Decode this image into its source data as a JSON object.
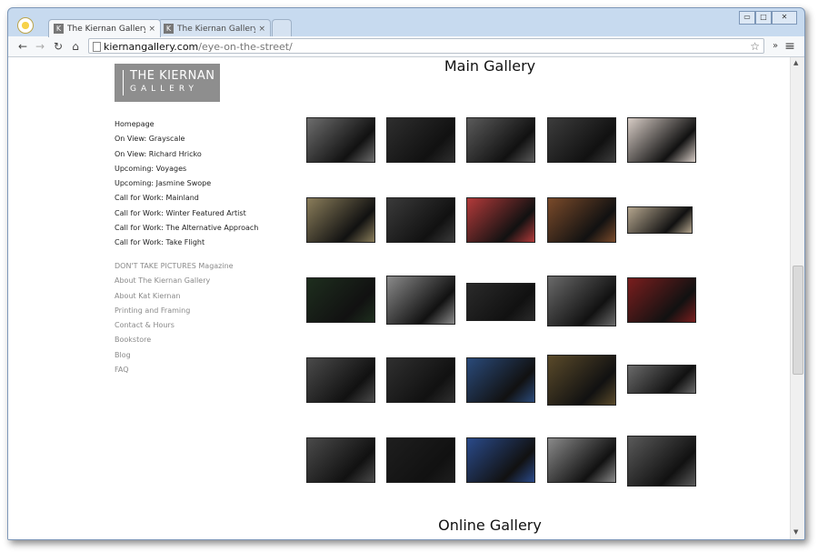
{
  "browser": {
    "tabs": [
      {
        "title": "The Kiernan Gallery - On V",
        "favicon": "K",
        "active": true
      },
      {
        "title": "The Kiernan Gallery: Eye o",
        "favicon": "K",
        "active": false
      }
    ],
    "url_host": "kiernangallery.com",
    "url_path": "/eye-on-the-street/",
    "icons": {
      "back": "←",
      "forward": "→",
      "reload": "↻",
      "home": "⌂",
      "star": "☆",
      "extensions": "»",
      "menu": "≡",
      "close": "×",
      "minimize": "▭",
      "maximize": "□",
      "window_close": "✕"
    }
  },
  "site": {
    "logo_line1": "THE KIERNAN",
    "logo_line2": "GALLERY",
    "nav_primary": [
      "Homepage",
      "On View: Grayscale",
      "On View: Richard Hricko",
      "Upcoming: Voyages",
      "Upcoming: Jasmine Swope",
      "Call for Work: Mainland",
      "Call for Work: Winter Featured Artist",
      "Call for Work: The Alternative Approach",
      "Call for Work: Take Flight"
    ],
    "nav_secondary": [
      "DON'T TAKE PICTURES Magazine",
      "About The Kiernan Gallery",
      "About Kat Kiernan",
      "Printing and Framing",
      "Contact & Hours",
      "Bookstore",
      "Blog",
      "FAQ"
    ]
  },
  "main": {
    "heading": "Main Gallery",
    "heading2": "Online Gallery",
    "thumbnails": [
      {
        "fill": "#6d6d6d"
      },
      {
        "fill": "#2e2e2e"
      },
      {
        "fill": "#5a5a5a"
      },
      {
        "fill": "#3c3c3c"
      },
      {
        "fill": "#d8cdc6"
      },
      {
        "fill": "#8a7d5a"
      },
      {
        "fill": "#3a3a3a"
      },
      {
        "fill": "#b33a3a"
      },
      {
        "fill": "#7a4a2a"
      },
      {
        "fill": "#b5a68e"
      },
      {
        "fill": "#1e2e1e"
      },
      {
        "fill": "#8a8a8a"
      },
      {
        "fill": "#2a2a2a"
      },
      {
        "fill": "#6a6a6a"
      },
      {
        "fill": "#7a1e1e"
      },
      {
        "fill": "#4a4a4a"
      },
      {
        "fill": "#2f2f2f"
      },
      {
        "fill": "#2a4a7a"
      },
      {
        "fill": "#5a4a2a"
      },
      {
        "fill": "#6a6a6a"
      },
      {
        "fill": "#4a4a4a"
      },
      {
        "fill": "#1e1e1e"
      },
      {
        "fill": "#2a4a8a"
      },
      {
        "fill": "#8a8a8a"
      },
      {
        "fill": "#5a5a5a"
      }
    ]
  }
}
